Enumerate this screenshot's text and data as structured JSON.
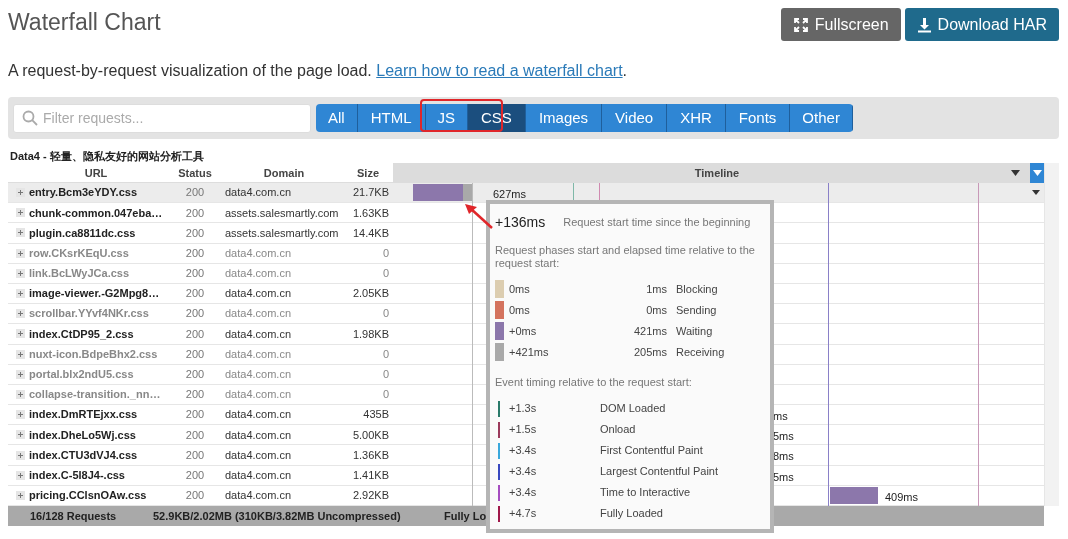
{
  "title": "Waterfall Chart",
  "actions": [
    {
      "label": "Fullscreen",
      "kind": "fullscreen"
    },
    {
      "label": "Download HAR",
      "kind": "download"
    }
  ],
  "intro": {
    "text": "A request-by-request visualization of the page load.",
    "link": "Learn how to read a waterfall chart",
    "after": "."
  },
  "filter": {
    "placeholder": "Filter requests..."
  },
  "filters": [
    {
      "label": "All",
      "selected": false
    },
    {
      "label": "HTML",
      "selected": false
    },
    {
      "label": "JS",
      "selected": false
    },
    {
      "label": "CSS",
      "selected": true
    },
    {
      "label": "Images",
      "selected": false
    },
    {
      "label": "Video",
      "selected": false
    },
    {
      "label": "XHR",
      "selected": false
    },
    {
      "label": "Fonts",
      "selected": false
    },
    {
      "label": "Other",
      "selected": false
    }
  ],
  "table": {
    "caption": "Data4 - 轻量、隐私友好的网站分析工具",
    "columns": [
      "URL",
      "Status",
      "Domain",
      "Size",
      "Timeline"
    ],
    "rows": [
      {
        "url": "entry.Bcm3eYDY.css",
        "status": "200",
        "domain": "data4.com.cn",
        "size": "21.7KB",
        "dimmed": false,
        "selected": true,
        "timing": "627ms"
      },
      {
        "url": "chunk-common.047eba…",
        "status": "200",
        "domain": "assets.salesmartly.com",
        "size": "1.63KB",
        "dimmed": false,
        "selected": false
      },
      {
        "url": "plugin.ca8811dc.css",
        "status": "200",
        "domain": "assets.salesmartly.com",
        "size": "14.4KB",
        "dimmed": false,
        "selected": false
      },
      {
        "url": "row.CKsrKEqU.css",
        "status": "200",
        "domain": "data4.com.cn",
        "size": "0",
        "dimmed": true,
        "selected": false
      },
      {
        "url": "link.BcLWyJCa.css",
        "status": "200",
        "domain": "data4.com.cn",
        "size": "0",
        "dimmed": true,
        "selected": false
      },
      {
        "url": "image-viewer.-G2Mpg8…",
        "status": "200",
        "domain": "data4.com.cn",
        "size": "2.05KB",
        "dimmed": false,
        "selected": false
      },
      {
        "url": "scrollbar.YYvf4NKr.css",
        "status": "200",
        "domain": "data4.com.cn",
        "size": "0",
        "dimmed": true,
        "selected": false
      },
      {
        "url": "index.CtDP95_2.css",
        "status": "200",
        "domain": "data4.com.cn",
        "size": "1.98KB",
        "dimmed": false,
        "selected": false
      },
      {
        "url": "nuxt-icon.BdpeBhx2.css",
        "status": "200",
        "domain": "data4.com.cn",
        "size": "0",
        "dimmed": true,
        "selected": false
      },
      {
        "url": "portal.blx2ndU5.css",
        "status": "200",
        "domain": "data4.com.cn",
        "size": "0",
        "dimmed": true,
        "selected": false
      },
      {
        "url": "collapse-transition._nn…",
        "status": "200",
        "domain": "data4.com.cn",
        "size": "0",
        "dimmed": true,
        "selected": false
      },
      {
        "url": "index.DmRTEjxx.css",
        "status": "200",
        "domain": "data4.com.cn",
        "size": "435B",
        "dimmed": false,
        "selected": false,
        "timing": "ms"
      },
      {
        "url": "index.DheLo5Wj.css",
        "status": "200",
        "domain": "data4.com.cn",
        "size": "5.00KB",
        "dimmed": false,
        "selected": false,
        "timing": "5ms"
      },
      {
        "url": "index.CTU3dVJ4.css",
        "status": "200",
        "domain": "data4.com.cn",
        "size": "1.36KB",
        "dimmed": false,
        "selected": false,
        "timing": "8ms"
      },
      {
        "url": "index.C-5l8J4-.css",
        "status": "200",
        "domain": "data4.com.cn",
        "size": "1.41KB",
        "dimmed": false,
        "selected": false,
        "timing": "5ms"
      },
      {
        "url": "pricing.CClsnOAw.css",
        "status": "200",
        "domain": "data4.com.cn",
        "size": "2.92KB",
        "dimmed": false,
        "selected": false,
        "timing": "409ms"
      }
    ],
    "footer": [
      "16/128 Requests",
      "52.9KB/2.02MB  (310KB/3.82MB Uncompressed)",
      "Fully Lo"
    ]
  },
  "tooltip": {
    "start": "+136ms",
    "start_label": "Request start time since the beginning",
    "phases_heading": "Request phases start and elapsed time relative to the request start:",
    "phases": [
      {
        "start": "0ms",
        "elapsed": "1ms",
        "name": "Blocking",
        "color": "#dccdb0"
      },
      {
        "start": "0ms",
        "elapsed": "0ms",
        "name": "Sending",
        "color": "#d4735e"
      },
      {
        "start": "+0ms",
        "elapsed": "421ms",
        "name": "Waiting",
        "color": "#8c77ab"
      },
      {
        "start": "+421ms",
        "elapsed": "205ms",
        "name": "Receiving",
        "color": "#a9a9a9"
      }
    ],
    "events_heading": "Event timing relative to the request start:",
    "events": [
      {
        "time": "+1.3s",
        "name": "DOM Loaded",
        "color": "#2a7a6a"
      },
      {
        "time": "+1.5s",
        "name": "Onload",
        "color": "#9b3a5c"
      },
      {
        "time": "+3.4s",
        "name": "First Contentful Paint",
        "color": "#3aa8dc"
      },
      {
        "time": "+3.4s",
        "name": "Largest Contentful Paint",
        "color": "#3848c0"
      },
      {
        "time": "+3.4s",
        "name": "Time to Interactive",
        "color": "#a54cc0"
      },
      {
        "time": "+4.7s",
        "name": "Fully Loaded",
        "color": "#a0184a"
      }
    ]
  }
}
